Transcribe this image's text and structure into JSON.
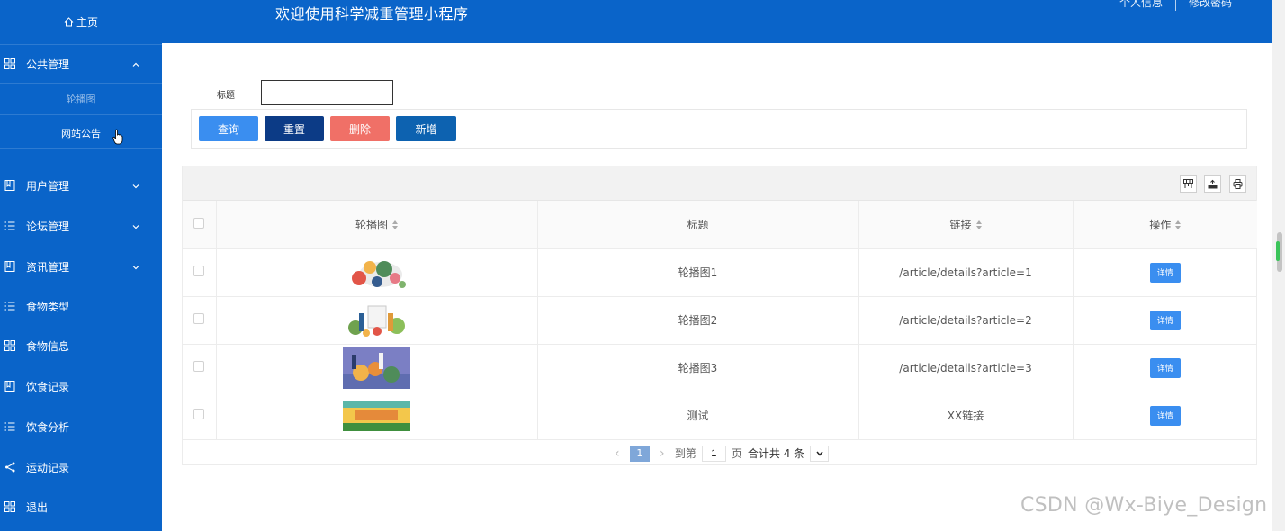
{
  "header": {
    "title": "欢迎使用科学减重管理小程序",
    "profile_link": "个人信息",
    "password_link": "修改密码"
  },
  "sidebar": {
    "home": "主页",
    "menus": [
      {
        "label": "公共管理",
        "icon": "grid-icon",
        "expanded": true
      },
      {
        "label": "用户管理",
        "icon": "book-icon"
      },
      {
        "label": "论坛管理",
        "icon": "list-icon"
      },
      {
        "label": "资讯管理",
        "icon": "book-icon"
      },
      {
        "label": "食物类型",
        "icon": "list-icon"
      },
      {
        "label": "食物信息",
        "icon": "grid-icon"
      },
      {
        "label": "饮食记录",
        "icon": "book-icon"
      },
      {
        "label": "饮食分析",
        "icon": "list-icon"
      },
      {
        "label": "运动记录",
        "icon": "share-icon"
      },
      {
        "label": "退出",
        "icon": "grid-icon"
      }
    ],
    "submenu": [
      "轮播图",
      "网站公告"
    ]
  },
  "search": {
    "label": "标题",
    "value": ""
  },
  "buttons": {
    "query": "查询",
    "reset": "重置",
    "delete": "删除",
    "add": "新增"
  },
  "table": {
    "columns": [
      "轮播图",
      "标题",
      "链接",
      "操作"
    ],
    "rows": [
      {
        "title": "轮播图1",
        "link": "/article/details?article=1",
        "action": "详情"
      },
      {
        "title": "轮播图2",
        "link": "/article/details?article=2",
        "action": "详情"
      },
      {
        "title": "轮播图3",
        "link": "/article/details?article=3",
        "action": "详情"
      },
      {
        "title": "测试",
        "link": "XX链接",
        "action": "详情"
      }
    ]
  },
  "pagination": {
    "current_page": "1",
    "goto_label": "到第",
    "goto_value": "1",
    "page_unit": "页",
    "total": "合计共 4 条"
  },
  "watermark": "CSDN @Wx-Biye_Design",
  "colors": {
    "primary": "#0a64c9",
    "query": "#3a8ef0",
    "reset": "#0c3b86",
    "delete": "#f07067",
    "add": "#0d62b0"
  }
}
